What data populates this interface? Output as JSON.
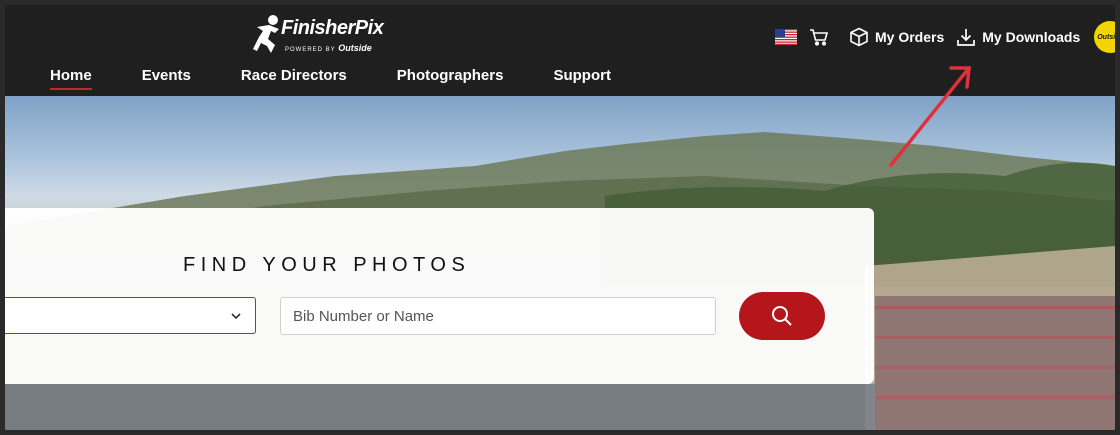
{
  "brand": {
    "name": "FinisherPix",
    "tagline": "POWERED BY",
    "partner": "Outside"
  },
  "nav": {
    "items": [
      {
        "label": "Home",
        "active": true
      },
      {
        "label": "Events",
        "active": false
      },
      {
        "label": "Race Directors",
        "active": false
      },
      {
        "label": "Photographers",
        "active": false
      },
      {
        "label": "Support",
        "active": false
      }
    ]
  },
  "tools": {
    "flag_icon": "us-flag-icon",
    "cart_icon": "cart-icon",
    "orders_label": "My Orders",
    "downloads_label": "My Downloads",
    "avatar_text": "Outside"
  },
  "search": {
    "title": "FIND YOUR PHOTOS",
    "event_value": "",
    "bib_placeholder": "Bib Number or Name",
    "button_icon": "search-icon"
  },
  "colors": {
    "accent": "#b5161b",
    "topbar": "#1f1f1f",
    "annotation_arrow": "#e0303a",
    "avatar": "#f2d500"
  }
}
